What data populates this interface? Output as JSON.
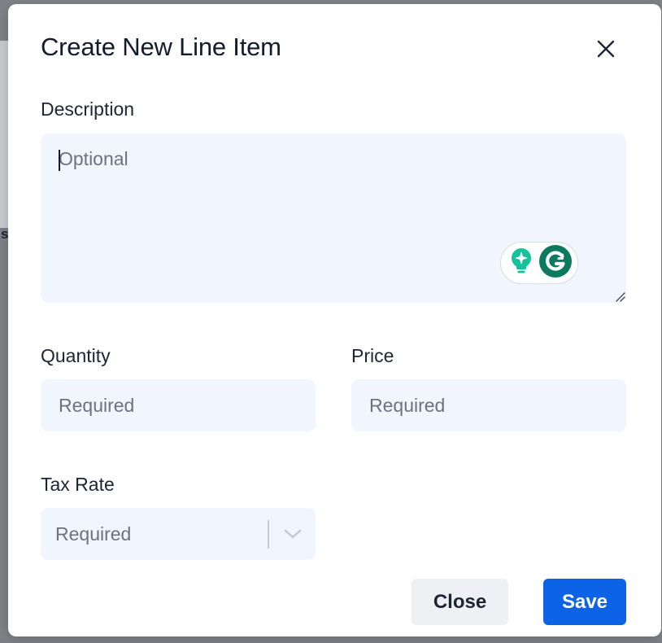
{
  "modal": {
    "title": "Create New Line Item"
  },
  "background": {
    "partial_char": "s"
  },
  "fields": {
    "description": {
      "label": "Description",
      "placeholder": "Optional"
    },
    "quantity": {
      "label": "Quantity",
      "placeholder": "Required"
    },
    "price": {
      "label": "Price",
      "placeholder": "Required"
    },
    "tax_rate": {
      "label": "Tax Rate",
      "value": "Required"
    }
  },
  "buttons": {
    "close_label": "Close",
    "save_label": "Save"
  },
  "icons": {
    "close": "close-icon",
    "grammarly_suggestion": "lightbulb-sparkle-icon",
    "grammarly": "grammarly-g-icon",
    "resize": "resize-handle-icon",
    "dropdown": "chevron-down-icon"
  },
  "colors": {
    "primary": "#0d63e6",
    "input_background": "#f1f5fd",
    "grammarly_teal": "#15c39a",
    "grammarly_dark": "#0b7a5f",
    "text": "#1d2535",
    "placeholder": "#6b7381"
  }
}
